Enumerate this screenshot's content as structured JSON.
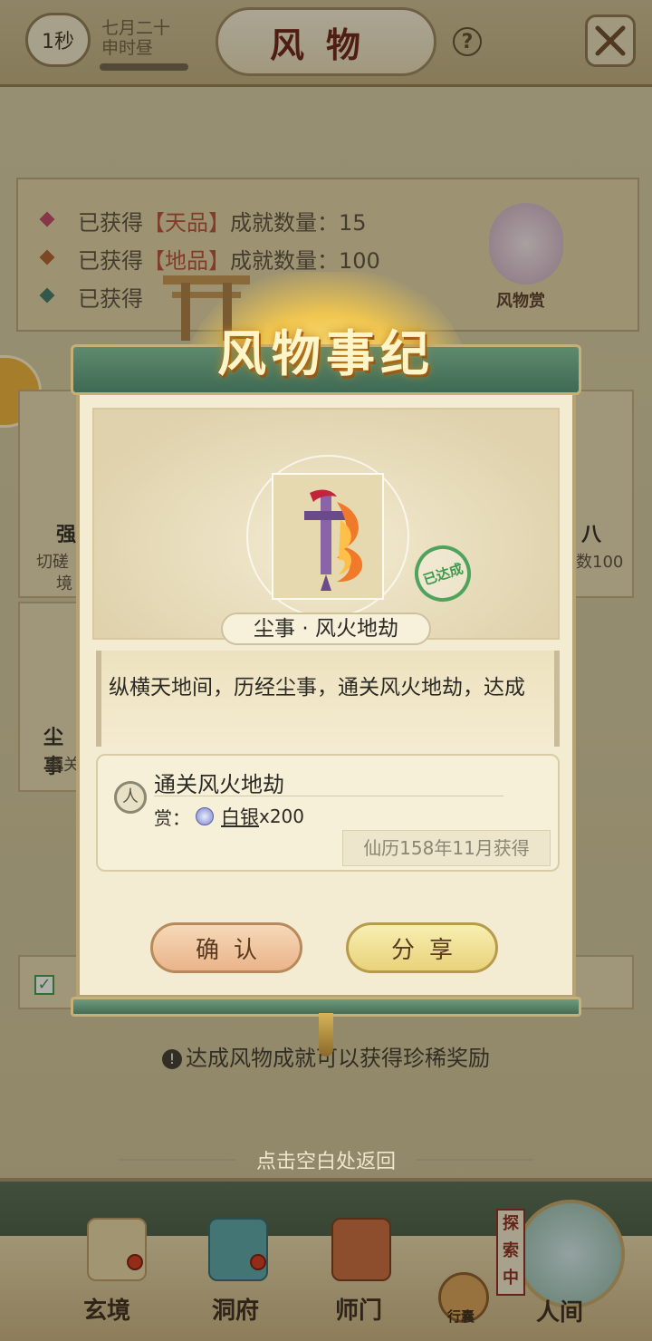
{
  "topbar": {
    "timer": "1秒",
    "date": "七月二十",
    "period": "申时昼",
    "title": "风物",
    "help": "?"
  },
  "achievements": {
    "heaven": {
      "prefix": "已获得",
      "grade": "【天品】",
      "suffix": "成就数量：15"
    },
    "earth": {
      "prefix": "已获得",
      "grade": "【地品】",
      "suffix": "成就数量：100"
    },
    "third": {
      "prefix": "已获得"
    },
    "reward_label": "风物赏"
  },
  "background_cards": {
    "card1_title": "强",
    "card1_text1": "切磋",
    "card1_text2": "境",
    "card2_title": "八",
    "card2_text": "数100",
    "card3_title": "尘事",
    "card3_text": "通关"
  },
  "tip": "达成风物成就可以获得珍稀奖励",
  "tap_return": "点击空白处返回",
  "nav": {
    "xuanjing": "玄境",
    "dongfu": "洞府",
    "shimen": "师门",
    "xingnang": "行囊",
    "explore": "探索中",
    "renjian": "人间"
  },
  "modal": {
    "title": "风物事纪",
    "badge": "已达成",
    "item_name": "尘事 · 风火地劫",
    "description": "纵横天地间，历经尘事，通关风火地劫，达成",
    "requirement_icon": "人",
    "requirement": "通关风火地劫",
    "reward_label": "赏：",
    "reward_item": "白银",
    "reward_qty": "x200",
    "acquired": "仙历158年11月获得",
    "confirm": "确认",
    "share": "分享"
  },
  "colors": {
    "accent_red": "#b8503a",
    "panel_green": "#4f7a60",
    "badge_green": "#4fa35c",
    "gold": "#f0c650"
  },
  "icons": {
    "close": "crossed-swords-icon",
    "reward_coin": "silver-coin-icon",
    "item": "flaming-sword-icon"
  }
}
